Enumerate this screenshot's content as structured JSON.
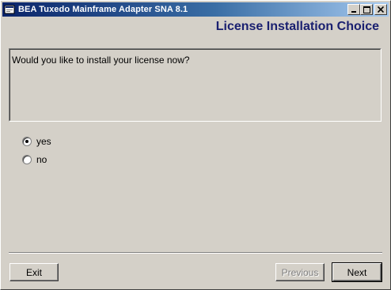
{
  "window": {
    "title": "BEA Tuxedo Mainframe Adapter SNA 8.1",
    "app_icon": "app-window-icon",
    "minimize_icon": "minimize-icon",
    "maximize_icon": "maximize-icon",
    "close_icon": "close-icon"
  },
  "page": {
    "heading": "License Installation Choice",
    "question": "Would you like to install your license now?"
  },
  "options": [
    {
      "label": "yes",
      "selected": true
    },
    {
      "label": "no",
      "selected": false
    }
  ],
  "buttons": {
    "exit": "Exit",
    "previous": "Previous",
    "previous_enabled": false,
    "next": "Next"
  },
  "colors": {
    "heading": "#1a2070",
    "titlebar_start": "#0a246a",
    "titlebar_end": "#a6caf0",
    "background": "#d4d0c8"
  }
}
